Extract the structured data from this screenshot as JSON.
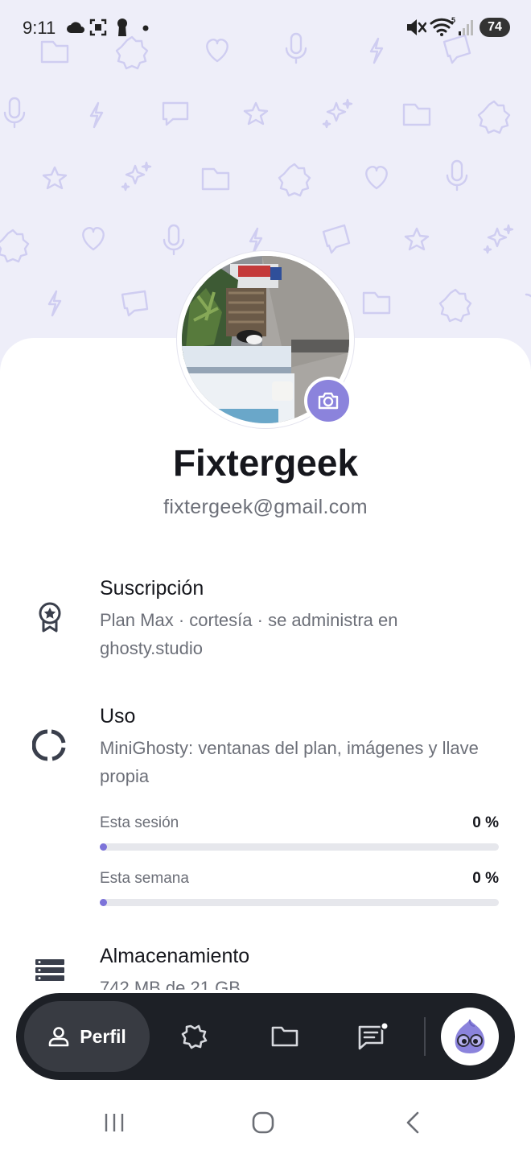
{
  "status_bar": {
    "time": "9:11",
    "battery": "74",
    "left_icons": [
      "cloud-icon",
      "screenshot-icon",
      "keyhole-icon",
      "dot-icon"
    ],
    "right_icons": [
      "mute-icon",
      "wifi-icon",
      "signal-icon"
    ]
  },
  "profile": {
    "name": "Fixtergeek",
    "email": "fixtergeek@gmail.com"
  },
  "subscription": {
    "title": "Suscripción",
    "subtitle": "Plan Max · cortesía · se administra en ghosty.studio"
  },
  "usage": {
    "title": "Uso",
    "subtitle": "MiniGhosty: ventanas del plan, imágenes y llave propia",
    "session": {
      "label": "Esta sesión",
      "value_text": "0 %",
      "fraction": 0
    },
    "week": {
      "label": "Esta semana",
      "value_text": "0 %",
      "fraction": 0
    }
  },
  "storage": {
    "title": "Almacenamiento",
    "subtitle": "742 MB de 21 GB"
  },
  "nav": {
    "active_label": "Perfil",
    "items": [
      "profile-icon",
      "puzzle-icon",
      "folder-icon",
      "chat-icon",
      "ghost-avatar"
    ]
  },
  "colors": {
    "accent": "#8b83dc",
    "nav_bg": "#1d2026",
    "header_bg": "#eeeef9",
    "pattern": "#cdcbf0"
  }
}
